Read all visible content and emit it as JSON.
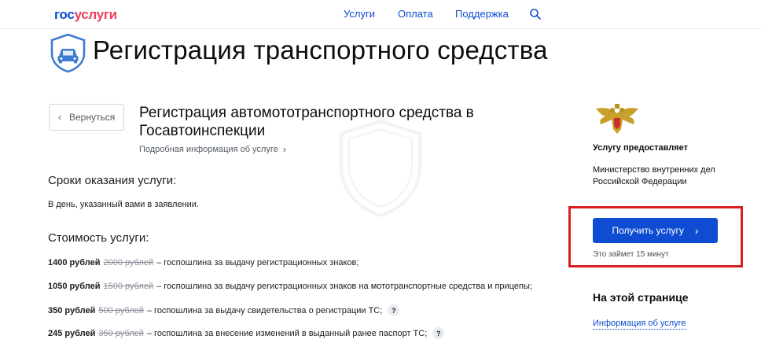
{
  "header": {
    "logo_part1": "гос",
    "logo_part2": "услуги",
    "nav": [
      "Услуги",
      "Оплата",
      "Поддержка"
    ],
    "search_icon": "search-icon"
  },
  "page": {
    "title": "Регистрация транспортного средства",
    "icon": "car-icon"
  },
  "service": {
    "back_label": "Вернуться",
    "title": "Регистрация автомототранспортного средства в Госавтоинспекции",
    "more_info": "Подробная информация об услуге"
  },
  "terms": {
    "heading": "Сроки оказания услуги:",
    "text": "В день, указанный вами в заявлении."
  },
  "cost": {
    "heading": "Стоимость услуги:",
    "items": [
      {
        "price": "1400 рублей",
        "old_price": "2000 рублей",
        "desc": "– госпошлина за выдачу регистрационных знаков;",
        "help": false
      },
      {
        "price": "1050 рублей",
        "old_price": "1500 рублей",
        "desc": "– госпошлина за выдачу регистрационных знаков на мототранспортные средства и прицепы;",
        "help": false
      },
      {
        "price": "350 рублей",
        "old_price": "500 рублей",
        "desc": "– госпошлина за выдачу свидетельства о регистрации ТС;",
        "help": true
      },
      {
        "price": "245 рублей",
        "old_price": "350 рублей",
        "desc": "– госпошлина за внесение изменений в выданный ранее паспорт ТС;",
        "help": true
      }
    ],
    "help_glyph": "?"
  },
  "provider": {
    "heading": "Услугу предоставляет",
    "name": "Министерство внутренних дел Российской Федерации"
  },
  "action": {
    "button_label": "Получить услугу",
    "duration": "Это займет 15 минут"
  },
  "on_page": {
    "heading": "На этой странице",
    "link": "Информация об услуге"
  },
  "colors": {
    "brand_blue": "#0d4cd3",
    "brand_red": "#ee3f58",
    "highlight_red": "#d81f1f"
  }
}
